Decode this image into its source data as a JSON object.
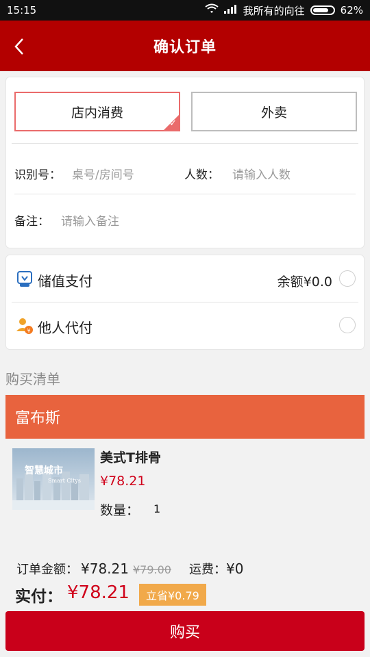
{
  "status_bar": {
    "time": "15:15",
    "carrier": "我所有的向往",
    "battery": "62%"
  },
  "header": {
    "title": "确认订单"
  },
  "order_mode": {
    "options": [
      "店内消费",
      "外卖"
    ],
    "selected": "店内消费"
  },
  "fields": {
    "id_label": "识别号：",
    "id_placeholder": "桌号/房间号",
    "people_label": "人数：",
    "people_placeholder": "请输入人数",
    "note_label": "备注：",
    "note_placeholder": "请输入备注"
  },
  "payment": {
    "stored_value_label": "储值支付",
    "balance_label": "余额",
    "balance_value": "¥0.0",
    "others_pay_label": "他人代付"
  },
  "list": {
    "section_title": "购买清单",
    "shop_name": "富布斯",
    "items": [
      {
        "name": "美式T排骨",
        "price": "¥78.21",
        "quantity_label": "数量：",
        "quantity": "1",
        "image_text": "智慧城市",
        "image_subtext": "Smart Citys"
      }
    ]
  },
  "summary": {
    "order_amount_label": "订单金额：",
    "order_amount": "¥78.21",
    "original_amount": "¥79.00",
    "shipping_label": "运费：",
    "shipping_value": "¥0",
    "paid_label": "实付：",
    "paid_value": "¥78.21",
    "save_badge": "立省¥0.79"
  },
  "actions": {
    "buy_button": "购买"
  },
  "colors": {
    "header_red": "#b30000",
    "shop_header_orange": "#e8633e",
    "price_red": "#d0021b",
    "buy_button_red": "#c9001a",
    "save_badge_orange": "#f1a94a",
    "selected_border": "#ea6b6b"
  }
}
